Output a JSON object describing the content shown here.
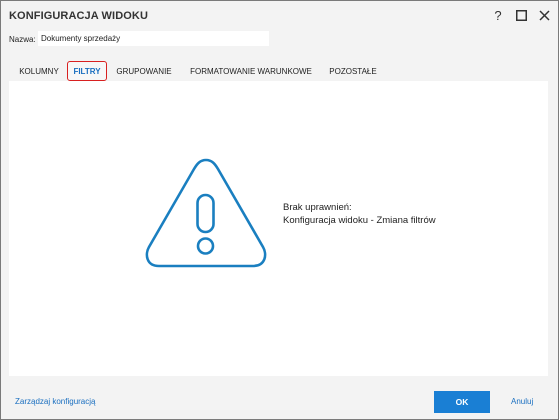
{
  "window": {
    "title": "KONFIGURACJA WIDOKU",
    "help_label": "?"
  },
  "name_field": {
    "label": "Nazwa:",
    "value": "Dokumenty sprzedaży"
  },
  "tabs": [
    {
      "label": "KOLUMNY",
      "active": false
    },
    {
      "label": "FILTRY",
      "active": true
    },
    {
      "label": "GRUPOWANIE",
      "active": false
    },
    {
      "label": "FORMATOWANIE WARUNKOWE",
      "active": false
    },
    {
      "label": "POZOSTAŁE",
      "active": false
    }
  ],
  "content": {
    "icon": "warning-triangle-icon",
    "message_line1": "Brak uprawnień:",
    "message_line2": "Konfiguracja widoku - Zmiana filtrów"
  },
  "footer": {
    "manage_link": "Zarządzaj konfiguracją",
    "ok_label": "OK",
    "cancel_label": "Anuluj"
  },
  "colors": {
    "accent": "#1a7fd4",
    "active_tab_border": "#d82020",
    "icon_stroke": "#1a7fc0"
  }
}
